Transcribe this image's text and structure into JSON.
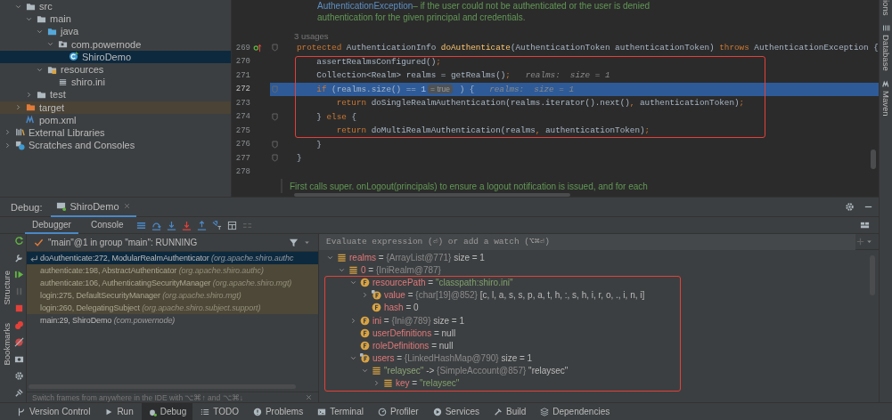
{
  "project_tree": [
    {
      "children": [
        {
          "label": "src",
          "kind": "folder",
          "expanded": true,
          "selected": false,
          "children": [
            {
              "label": "main",
              "kind": "folder",
              "expanded": true,
              "selected": false,
              "children": [
                {
                  "label": "java",
                  "kind": "source-folder",
                  "expanded": true,
                  "selected": false,
                  "children": [
                    {
                      "label": "com.powernode",
                      "kind": "package",
                      "expanded": true,
                      "selected": false,
                      "children": [
                        {
                          "label": "ShiroDemo",
                          "kind": "class",
                          "selected": true
                        }
                      ]
                    }
                  ]
                },
                {
                  "label": "resources",
                  "kind": "resources-folder",
                  "expanded": true,
                  "selected": false,
                  "children": [
                    {
                      "label": "shiro.ini",
                      "kind": "ini-file",
                      "selected": false
                    }
                  ]
                }
              ]
            },
            {
              "label": "test",
              "kind": "folder",
              "expanded": false,
              "selected": false
            }
          ]
        },
        {
          "label": "target",
          "kind": "excluded-folder",
          "expanded": false,
          "selected": false
        },
        {
          "label": "pom.xml",
          "kind": "maven-file",
          "selected": false
        }
      ]
    },
    {
      "label": "External Libraries",
      "kind": "libraries",
      "expanded": false,
      "selected": false
    },
    {
      "label": "Scratches and Consoles",
      "kind": "scratches",
      "expanded": false,
      "selected": false
    }
  ],
  "editor": {
    "doc_top": [
      [
        {
          "text": "AuthenticationException",
          "kind": "link"
        },
        {
          "text": " – if the user could not be authenticated or the user is denied",
          "kind": "doc"
        }
      ],
      [
        {
          "text": "authentication for the given principal and credentials.",
          "kind": "doc"
        }
      ]
    ],
    "usages": "3 usages",
    "lines": [
      {
        "number": "269",
        "kind": "method-start",
        "current": false,
        "boxed": false,
        "fold": true,
        "tokens": [
          {
            "text": "protected",
            "kind": "kw"
          },
          {
            "text": " AuthenticationInfo ",
            "kind": "plain"
          },
          {
            "text": "doAuthenticate",
            "kind": "decl"
          },
          {
            "text": "(AuthenticationToken authenticationToken) ",
            "kind": "plain"
          },
          {
            "text": "throws",
            "kind": "kw"
          },
          {
            "text": " AuthenticationException {",
            "kind": "plain"
          }
        ]
      },
      {
        "number": "270",
        "kind": "plain",
        "current": false,
        "boxed": true,
        "fold": false,
        "tokens": [
          {
            "text": "    assertRealmsConfigured()",
            "kind": "plain"
          },
          {
            "text": ";",
            "kind": "kw"
          }
        ]
      },
      {
        "number": "271",
        "kind": "plain",
        "current": false,
        "boxed": true,
        "fold": false,
        "tokens": [
          {
            "text": "    Collection<Realm> realms = getRealms()",
            "kind": "plain"
          },
          {
            "text": ";",
            "kind": "kw"
          },
          {
            "text": "   realms:  size = 1",
            "kind": "hint"
          }
        ]
      },
      {
        "number": "272",
        "kind": "plain",
        "current": true,
        "boxed": true,
        "fold": true,
        "tokens": [
          {
            "text": "    if",
            "kind": "kw"
          },
          {
            "text": " (realms.size() == ",
            "kind": "plain"
          },
          {
            "text": "1",
            "kind": "num"
          },
          {
            "text": "= true",
            "kind": "inlay"
          },
          {
            "text": " ) {",
            "kind": "plain"
          },
          {
            "text": "   realms:  size = 1",
            "kind": "hint"
          }
        ]
      },
      {
        "number": "273",
        "kind": "plain",
        "current": false,
        "boxed": true,
        "fold": false,
        "tokens": [
          {
            "text": "        return",
            "kind": "kw"
          },
          {
            "text": " doSingleRealmAuthentication(realms.iterator().next()",
            "kind": "plain"
          },
          {
            "text": ",",
            "kind": "kw"
          },
          {
            "text": " authenticationToken)",
            "kind": "plain"
          },
          {
            "text": ";",
            "kind": "kw"
          }
        ]
      },
      {
        "number": "274",
        "kind": "plain",
        "current": false,
        "boxed": true,
        "fold": true,
        "tokens": [
          {
            "text": "    } ",
            "kind": "plain"
          },
          {
            "text": "else",
            "kind": "kw"
          },
          {
            "text": " {",
            "kind": "plain"
          }
        ]
      },
      {
        "number": "275",
        "kind": "plain",
        "current": false,
        "boxed": true,
        "fold": false,
        "tokens": [
          {
            "text": "        return",
            "kind": "kw"
          },
          {
            "text": " doMultiRealmAuthentication(realms",
            "kind": "plain"
          },
          {
            "text": ",",
            "kind": "kw"
          },
          {
            "text": " authenticationToken)",
            "kind": "plain"
          },
          {
            "text": ";",
            "kind": "kw"
          }
        ]
      },
      {
        "number": "276",
        "kind": "plain",
        "current": false,
        "boxed": false,
        "fold": true,
        "tokens": [
          {
            "text": "    }",
            "kind": "plain"
          }
        ]
      },
      {
        "number": "277",
        "kind": "plain",
        "current": false,
        "boxed": false,
        "fold": true,
        "tokens": [
          {
            "text": "}",
            "kind": "plain"
          }
        ]
      },
      {
        "number": "278",
        "kind": "plain",
        "current": false,
        "boxed": false,
        "fold": false
      }
    ],
    "doc_bottom": "First calls super. onLogout(principals) to ensure a logout notification is issued, and for each"
  },
  "right_stripe": [
    {
      "label": "ions",
      "kind": "plain"
    },
    {
      "label": "Database",
      "kind": "database"
    },
    {
      "label": "Maven",
      "kind": "maven"
    }
  ],
  "left_stripe": [
    "Structure",
    "Bookmarks"
  ],
  "debug": {
    "label": "Debug:",
    "tabs": [
      {
        "label": "ShiroDemo",
        "selected": true
      }
    ],
    "subtabs": [
      {
        "label": "Debugger",
        "selected": true
      },
      {
        "label": "Console",
        "selected": false
      }
    ],
    "thread": "\"main\"@1 in group \"main\": RUNNING",
    "frames": [
      {
        "method": "doAuthenticate:272, ModularRealmAuthenticator",
        "package": "(org.apache.shiro.authc",
        "kind": "current",
        "selected": true
      },
      {
        "method": "authenticate:198, AbstractAuthenticator",
        "package": "(org.apache.shiro.authc)",
        "kind": "library",
        "selected": false
      },
      {
        "method": "authenticate:106, AuthenticatingSecurityManager",
        "package": "(org.apache.shiro.mgt)",
        "kind": "library",
        "selected": false
      },
      {
        "method": "login:275, DefaultSecurityManager",
        "package": "(org.apache.shiro.mgt)",
        "kind": "library",
        "selected": false
      },
      {
        "method": "login:260, DelegatingSubject",
        "package": "(org.apache.shiro.subject.support)",
        "kind": "library",
        "selected": false
      },
      {
        "method": "main:29, ShiroDemo",
        "package": "(com.powernode)",
        "kind": "normal",
        "selected": false
      }
    ],
    "hint": "Switch frames from anywhere in the IDE with ⌥⌘↑ and ⌥⌘↓",
    "watch_placeholder": "Evaluate expression (⏎) or add a watch (⌥⌘⏎)",
    "variables": [
      {
        "name": "realms",
        "kind": "list-object",
        "sep": "=",
        "value": "{ArrayList@771}",
        "detail": "size = 1",
        "expanded": true,
        "boxed": false,
        "children": [
          {
            "name": "0",
            "kind": "list-object",
            "sep": "=",
            "value": "{IniRealm@787}",
            "expanded": true,
            "boxed": false,
            "children": [
              {
                "name": "resourcePath",
                "kind": "field-string",
                "sep": "=",
                "value": "\"classpath:shiro.ini\"",
                "expanded": true,
                "boxed": true,
                "children": [
                  {
                    "name": "value",
                    "kind": "final-object",
                    "sep": "=",
                    "value": "{char[19]@852}",
                    "detail": "[c, l, a, s, s, p, a, t, h, :, s, h, i, r, o, ., i, n, i]",
                    "expanded": false,
                    "boxed": true
                  },
                  {
                    "name": "hash",
                    "kind": "field-plain",
                    "sep": "=",
                    "value": "0",
                    "boxed": true
                  }
                ]
              },
              {
                "name": "ini",
                "kind": "field-object",
                "sep": "=",
                "value": "{Ini@789}",
                "detail": "size = 1",
                "expanded": false,
                "boxed": true
              },
              {
                "name": "userDefinitions",
                "kind": "field-plain",
                "sep": "=",
                "value": "null",
                "boxed": true
              },
              {
                "name": "roleDefinitions",
                "kind": "field-plain",
                "sep": "=",
                "value": "null",
                "boxed": true
              },
              {
                "name": "users",
                "kind": "final-object",
                "sep": "=",
                "value": "{LinkedHashMap@790}",
                "detail": "size = 1",
                "expanded": true,
                "boxed": true,
                "children": [
                  {
                    "name": "\"relaysec\"",
                    "kind": "entry-object",
                    "sep": "->",
                    "value": "{SimpleAccount@857}",
                    "detail": "\"relaysec\"",
                    "expanded": true,
                    "boxed": true,
                    "children": [
                      {
                        "name": "key",
                        "kind": "list-string",
                        "sep": "=",
                        "value": "\"relaysec\"",
                        "expanded": false,
                        "boxed": true
                      }
                    ]
                  }
                ]
              }
            ]
          }
        ]
      }
    ]
  },
  "tool_buttons": [
    {
      "label": "Version Control",
      "kind": "vcs",
      "selected": false
    },
    {
      "label": "Run",
      "kind": "run",
      "selected": false
    },
    {
      "label": "Debug",
      "kind": "debug",
      "selected": true
    },
    {
      "label": "TODO",
      "kind": "todo",
      "selected": false
    },
    {
      "label": "Problems",
      "kind": "problems",
      "selected": false
    },
    {
      "label": "Terminal",
      "kind": "terminal",
      "selected": false
    },
    {
      "label": "Profiler",
      "kind": "profiler",
      "selected": false
    },
    {
      "label": "Services",
      "kind": "services",
      "selected": false
    },
    {
      "label": "Build",
      "kind": "build",
      "selected": false
    },
    {
      "label": "Dependencies",
      "kind": "dependencies",
      "selected": false
    }
  ]
}
